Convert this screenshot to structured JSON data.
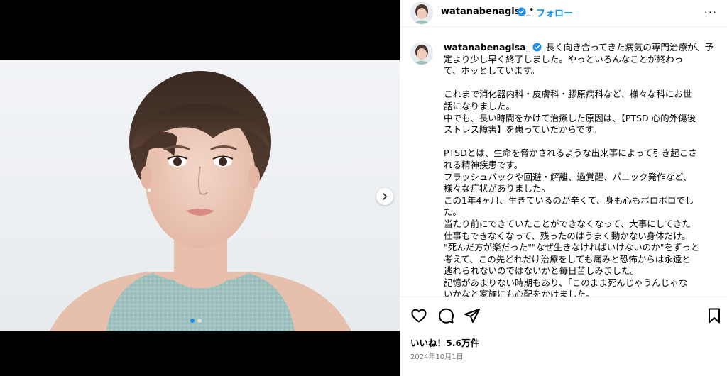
{
  "post": {
    "username": "watanabenagisa_",
    "separator": "•",
    "follow_label": "フォロー",
    "more_label": "···",
    "caption_lines": [
      "長く向き合ってきた病気の専門治療が、予",
      "定より少し早く終了しました。やっといろんなことが終わっ",
      "て、ホッとしています。",
      "",
      "これまで消化器内科・皮膚科・膠原病科など、様々な科にお世",
      "話になりました。",
      "中でも、長い時間をかけて治療した原因は、【PTSD 心的外傷後",
      "ストレス障害】を患っていたからです。",
      "",
      "PTSDとは、生命を脅かされるような出来事によって引き起こさ",
      "れる精神疾患です。",
      "フラッシュバックや回避・解離、過覚醒、パニック発作など、",
      "様々な症状がありました。",
      "この1年4ヶ月、生きているのが辛くて、身も心もボロボロでし",
      "た。",
      "当たり前にできていたことができなくなって、大事にしてきた",
      "仕事もできなくなって、残ったのはうまく動かない身体だけ。",
      "\"死んだ方が楽だった\"\"なぜ生きなければいけないのか\"をずっと",
      "考えて、この先どれだけ治療をしても痛みと恐怖からは永遠と",
      "逃れられないのではないかと毎日苦しみました。",
      "記憶があまりない時期もあり、「このまま死んじゃうんじゃな",
      "いかなと家族にも心配をかけました。"
    ],
    "likes_label": "いいね！5.6万件",
    "date_label": "2024年10月1日",
    "carousel": {
      "total": 2,
      "current": 1
    }
  },
  "colors": {
    "accent": "#0095f6",
    "verified": "#1e8ee6",
    "muted": "#737373",
    "divider": "#efefef",
    "dress": "#9fc1be"
  },
  "icons": {
    "like": "heart-icon",
    "comment": "comment-icon",
    "share": "share-icon",
    "save": "bookmark-icon",
    "next": "chevron-right-icon",
    "more": "more-icon",
    "verified": "verified-badge-icon"
  }
}
